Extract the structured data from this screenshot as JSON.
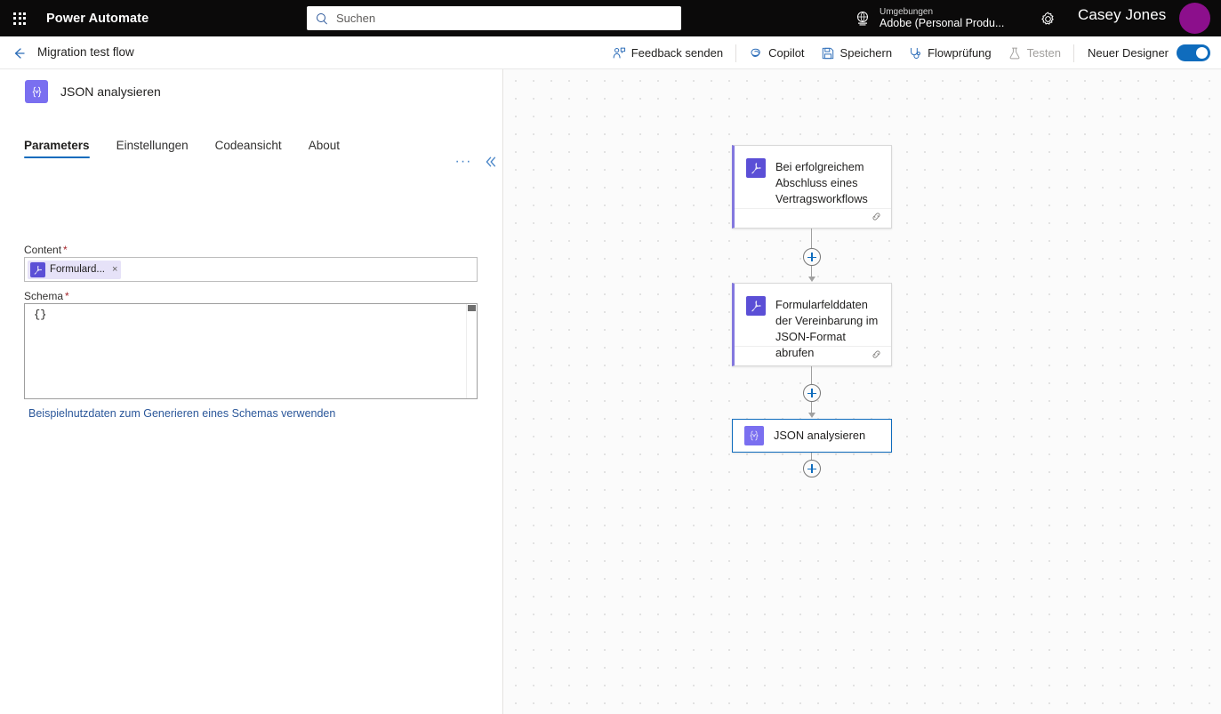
{
  "topbar": {
    "waffle_name": "app-launcher",
    "brand": "Power Automate",
    "search_placeholder": "Suchen",
    "search_value": "",
    "environment_label": "Umgebungen",
    "environment_value": "Adobe (Personal Produ...",
    "user_name": "Casey Jones",
    "avatar_color": "#8c0f8c"
  },
  "commandbar": {
    "flow_title": "Migration test flow",
    "actions": [
      {
        "label": "Feedback senden",
        "icon": "feedback-icon",
        "disabled": false
      },
      {
        "label": "Copilot",
        "icon": "copilot-icon",
        "disabled": false
      },
      {
        "label": "Speichern",
        "icon": "save-icon",
        "disabled": false
      },
      {
        "label": "Flowprüfung",
        "icon": "stethoscope-icon",
        "disabled": false
      },
      {
        "label": "Testen",
        "icon": "flask-icon",
        "disabled": true
      }
    ],
    "toggle_label": "Neuer Designer",
    "toggle_on": true,
    "accent_color": "#0f6cbd"
  },
  "panel": {
    "title": "JSON analysieren",
    "icon": "json-braces-icon",
    "more_label": "···",
    "collapse_label": "«",
    "tabs": [
      {
        "label": "Parameters",
        "active": true
      },
      {
        "label": "Einstellungen",
        "active": false
      },
      {
        "label": "Codeansicht",
        "active": false
      },
      {
        "label": "About",
        "active": false
      }
    ],
    "content_field": {
      "label": "Content",
      "required_marker": "*",
      "chip_text": "Formulard...",
      "chip_icon": "adobe-pdf-icon",
      "chip_remove": "×"
    },
    "schema_field": {
      "label": "Schema",
      "required_marker": "*",
      "value": "{}"
    },
    "sample_link": "Beispielnutzdaten zum Generieren eines Schemas verwenden"
  },
  "canvas": {
    "nodes": [
      {
        "id": "trigger",
        "title": "Bei erfolgreichem Abschluss eines Vertragsworkflows",
        "icon": "adobe-pdf-icon",
        "footer_icon": "link-chain-icon",
        "selected": false
      },
      {
        "id": "get-form-data",
        "title": "Formularfelddaten der Vereinbarung im JSON-Format abrufen",
        "icon": "adobe-pdf-icon",
        "footer_icon": "link-chain-icon",
        "selected": false
      },
      {
        "id": "parse-json",
        "title": "JSON analysieren",
        "icon": "json-braces-icon",
        "selected": true
      }
    ],
    "add_button_label": "+"
  }
}
